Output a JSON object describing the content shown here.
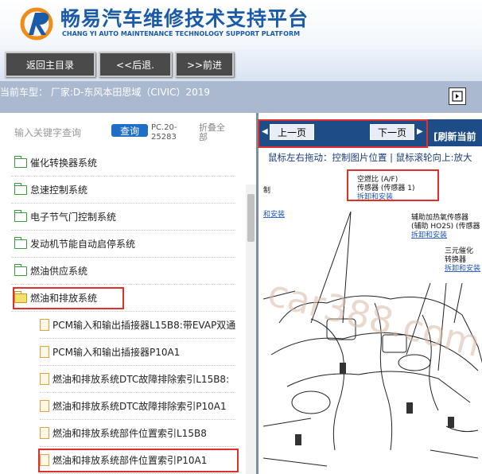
{
  "header": {
    "title": "畅易汽车维修技术支持平台",
    "subtitle": "CHANG YI AUTO MAINTENANCE TECHNOLOGY SUPPORT PLATFORM"
  },
  "nav": {
    "home_label": "返回主目录",
    "back_label": "<<后退.",
    "forward_label": ">>前进"
  },
  "vehicle": {
    "label": "当前车型：  厂家:D-东风本田思域（CIVIC）2019"
  },
  "search": {
    "placeholder": "输入关键字查询",
    "button_label": "查询",
    "code": "PC.20-25283",
    "collapse_label": "折叠全部"
  },
  "tree": {
    "items": [
      {
        "label": "催化转换器系统"
      },
      {
        "label": "怠速控制系统"
      },
      {
        "label": "电子节气门控制系统"
      },
      {
        "label": "发动机节能自动启停系统"
      },
      {
        "label": "燃油供应系统"
      },
      {
        "label": "燃油和排放系统"
      },
      {
        "label": "PCM输入和输出插接器L15B8:带EVAP双通"
      },
      {
        "label": "PCM输入和输出插接器P10A1"
      },
      {
        "label": "燃油和排放系统DTC故障排除索引L15B8:"
      },
      {
        "label": "燃油和排放系统DTC故障排除索引P10A1"
      },
      {
        "label": "燃油和排放系统部件位置索引L15B8"
      },
      {
        "label": "燃油和排放系统部件位置索引P10A1"
      }
    ]
  },
  "viewer": {
    "prev_label": "上一页",
    "next_label": "下一页",
    "refresh_label": "[刷新当前",
    "hint": "鼠标左右拖动：控制图片位置  |  鼠标滚轮向上:放大",
    "diagram": {
      "callout_1": "空燃比 (A/F)",
      "callout_2": "传感器 (传感器 1)",
      "callout_3": "拆卸和安装",
      "callout_4": "辅助加热氧传感器",
      "callout_5": "(辅助 HO2S) (传感器 2)",
      "callout_6": "拆卸和安装",
      "callout_7": "三元催化",
      "callout_8": "转换器",
      "callout_9": "拆卸和安装",
      "edge_1": "制",
      "edge_2": "和安装",
      "watermark": "car388.com"
    }
  },
  "colors": {
    "brand_blue": "#1a5aa8",
    "pager_bar": "#1d4c86",
    "highlight": "#e0302b",
    "vehicle_bar": "#aab9cf"
  }
}
